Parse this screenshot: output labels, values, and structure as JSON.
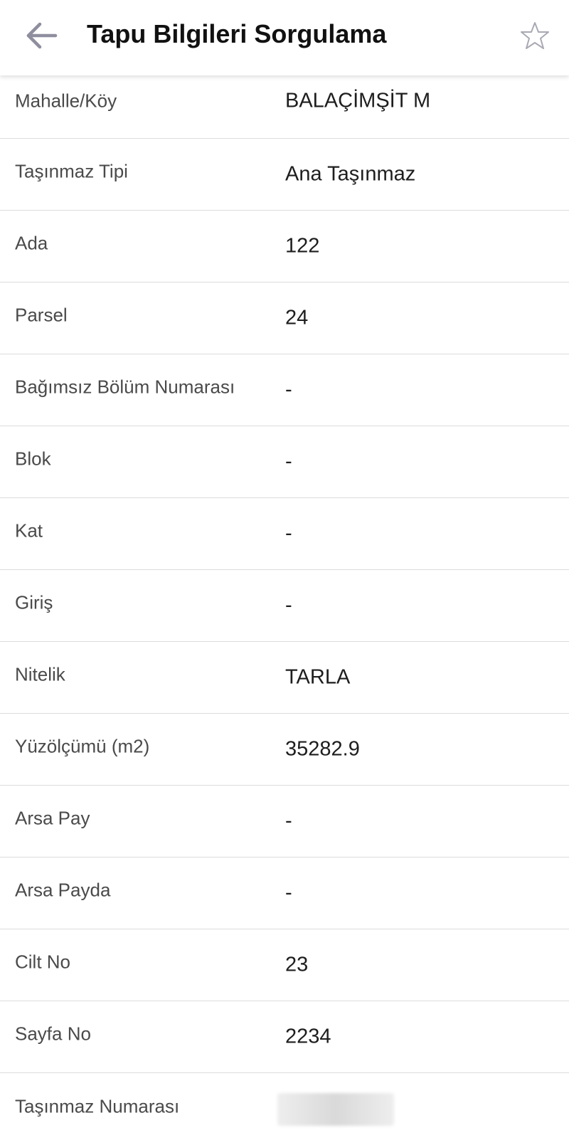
{
  "header": {
    "title": "Tapu Bilgileri Sorgulama",
    "back_icon": "arrow-left-icon",
    "favorite_icon": "star-outline-icon"
  },
  "colors": {
    "icon_gray": "#8e8e9e",
    "divider": "#dcdcdc",
    "label_text": "#4a4a4a",
    "value_text": "#1e1e1e"
  },
  "rows": [
    {
      "label": "Mahalle/Köy",
      "value": "BALAÇİMŞİT M"
    },
    {
      "label": "Taşınmaz Tipi",
      "value": "Ana Taşınmaz"
    },
    {
      "label": "Ada",
      "value": "122"
    },
    {
      "label": "Parsel",
      "value": "24"
    },
    {
      "label": "Bağımsız Bölüm Numarası",
      "value": "-"
    },
    {
      "label": "Blok",
      "value": "-"
    },
    {
      "label": "Kat",
      "value": "-"
    },
    {
      "label": "Giriş",
      "value": "-"
    },
    {
      "label": "Nitelik",
      "value": "TARLA"
    },
    {
      "label": "Yüzölçümü (m2)",
      "value": "35282.9"
    },
    {
      "label": "Arsa Pay",
      "value": "-"
    },
    {
      "label": "Arsa Payda",
      "value": "-"
    },
    {
      "label": "Cilt No",
      "value": "23"
    },
    {
      "label": "Sayfa No",
      "value": "2234"
    },
    {
      "label": "Taşınmaz Numarası",
      "value": ""
    }
  ]
}
